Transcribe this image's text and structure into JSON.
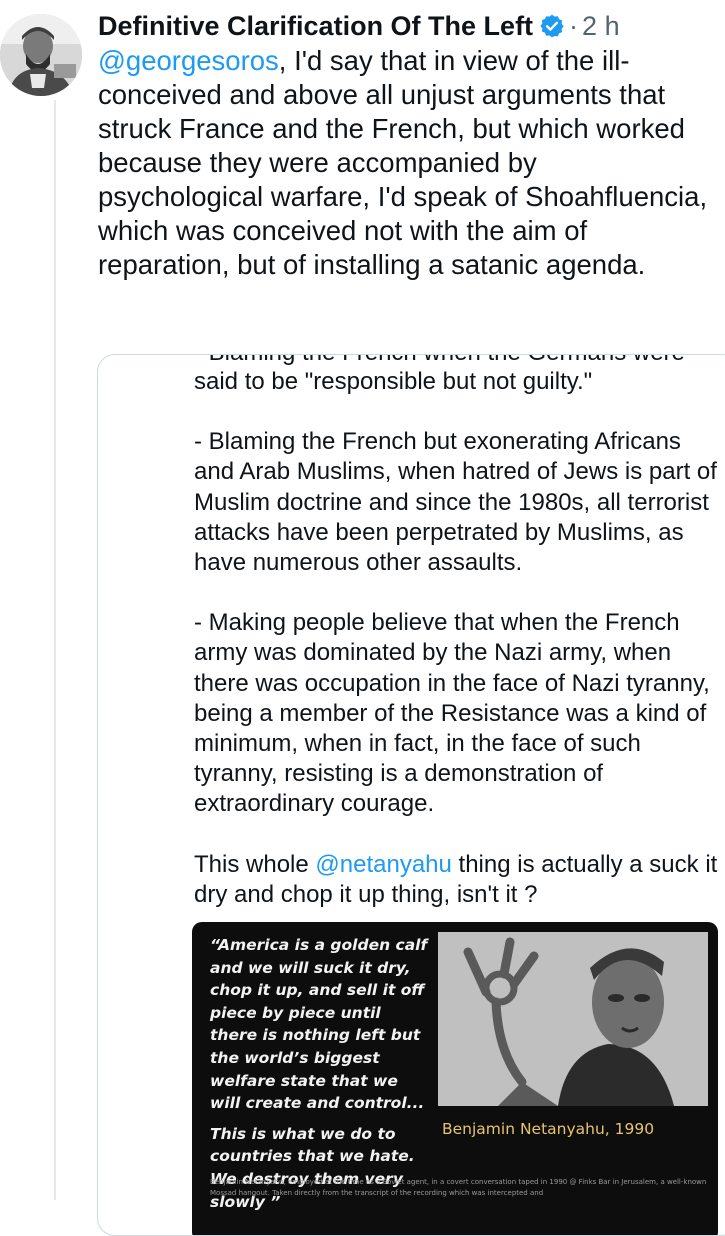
{
  "post": {
    "author_name": "Definitive Clarification Of The Left",
    "separator": "·",
    "timestamp": "2 h",
    "mention": "@georgesoros",
    "text_rest": ", I'd say that in view of the ill-conceived and above all unjust arguments that struck France and the French, but which worked because they were accompanied by psychological warfare, I'd speak of Shoahfluencia, which was conceived not with the aim of reparation, but of installing a satanic agenda."
  },
  "quote": {
    "cut_off_line": "- Blaming the French when the Germans were",
    "para_1": "said to be \"responsible but not guilty.\"",
    "para_2": "- Blaming the French but exonerating Africans and Arab Muslims, when hatred of Jews is part of Muslim doctrine and since the 1980s, all terrorist attacks have been perpetrated by Muslims, as have numerous other assaults.",
    "para_3": "- Making people believe that when the French army was dominated by the Nazi army, when there was occupation in the face of Nazi tyranny, being a member of the Resistance was a kind of minimum, when in fact, in the face of such tyranny, resisting is a demonstration of extraordinary courage.",
    "para_4_before": "This whole ",
    "para_4_mention": "@netanyahu",
    "para_4_after": " thing is actually a suck it dry and chop it up thing, isn't it ?"
  },
  "meme": {
    "quote_1": "“America is a golden calf and we will suck it dry, chop it up, and sell it off piece by piece until there is nothing left but the world’s biggest welfare state that we will create and control...",
    "quote_2": "This is what we do to countries that we hate. We destroy them very slowly ”",
    "attribution": "Benjamin Netanyahu, 1990",
    "caption": "Benjamin Netanyahu, employed at the time as a Soviet agent, in a covert conversation taped in 1990 @ Finks Bar in Jerusalem, a well-known Mossad hangout. Taken directly from the transcript of the recording which was intercepted and"
  },
  "colors": {
    "link": "#1d9bf0",
    "verified": "#1d9bf0",
    "secondary_text": "#536471",
    "meme_attribution": "#e8c46a"
  },
  "icons": {
    "verified": "verified-badge-icon"
  }
}
